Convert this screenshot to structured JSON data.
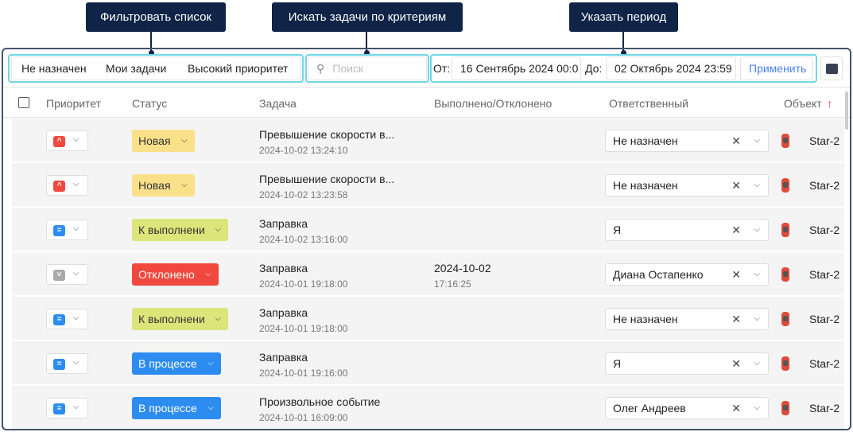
{
  "callouts": [
    "Фильтровать список",
    "Искать задачи по критериям",
    "Указать период"
  ],
  "filters": [
    "Не назначен",
    "Мои задачи",
    "Высокий приоритет"
  ],
  "search": {
    "placeholder": "Поиск"
  },
  "period": {
    "from_label": "От:",
    "from": "16 Сентябрь 2024 00:0",
    "to_label": "До:",
    "to": "02 Октябрь 2024 23:59",
    "apply": "Применить"
  },
  "headers": [
    "Приоритет",
    "Статус",
    "Задача",
    "Выполнено/Отклонено",
    "Ответственный",
    "Объект"
  ],
  "sort_icon": "↑",
  "rows": [
    {
      "priority": "high",
      "status": "Новая",
      "task": "Превышение скорости в...",
      "date": "2024-10-02 13:24:10",
      "done_date": "",
      "done_time": "",
      "responsible": "Не назначен",
      "object": "Star-2"
    },
    {
      "priority": "high",
      "status": "Новая",
      "task": "Превышение скорости в...",
      "date": "2024-10-02 13:23:58",
      "done_date": "",
      "done_time": "",
      "responsible": "Не назначен",
      "object": "Star-2"
    },
    {
      "priority": "normal",
      "status": "К выполнени",
      "task": "Заправка",
      "date": "2024-10-02 13:16:00",
      "done_date": "",
      "done_time": "",
      "responsible": "Я",
      "object": "Star-2"
    },
    {
      "priority": "none",
      "status": "Отклонено",
      "task": "Заправка",
      "date": "2024-10-01 19:18:00",
      "done_date": "2024-10-02",
      "done_time": "17:16:25",
      "responsible": "Диана Остапенко",
      "object": "Star-2"
    },
    {
      "priority": "normal",
      "status": "К выполнени",
      "task": "Заправка",
      "date": "2024-10-01 19:18:00",
      "done_date": "",
      "done_time": "",
      "responsible": "Не назначен",
      "object": "Star-2"
    },
    {
      "priority": "normal",
      "status": "В процессе",
      "task": "Заправка",
      "date": "2024-10-01 19:16:00",
      "done_date": "",
      "done_time": "",
      "responsible": "Я",
      "object": "Star-2"
    },
    {
      "priority": "normal",
      "status": "В процессе",
      "task": "Произвольное событие",
      "date": "2024-10-01 16:09:00",
      "done_date": "",
      "done_time": "",
      "responsible": "Олег Андреев",
      "object": "Star-2"
    }
  ],
  "colors": {
    "high": "#f0483e",
    "normal": "#2d8cf0",
    "none": "#a9a9a9",
    "Новая": "#fbe08a",
    "К выполнени": "#dce57a",
    "Отклонено": "#f0483e",
    "В процессе": "#2d8cf0"
  }
}
